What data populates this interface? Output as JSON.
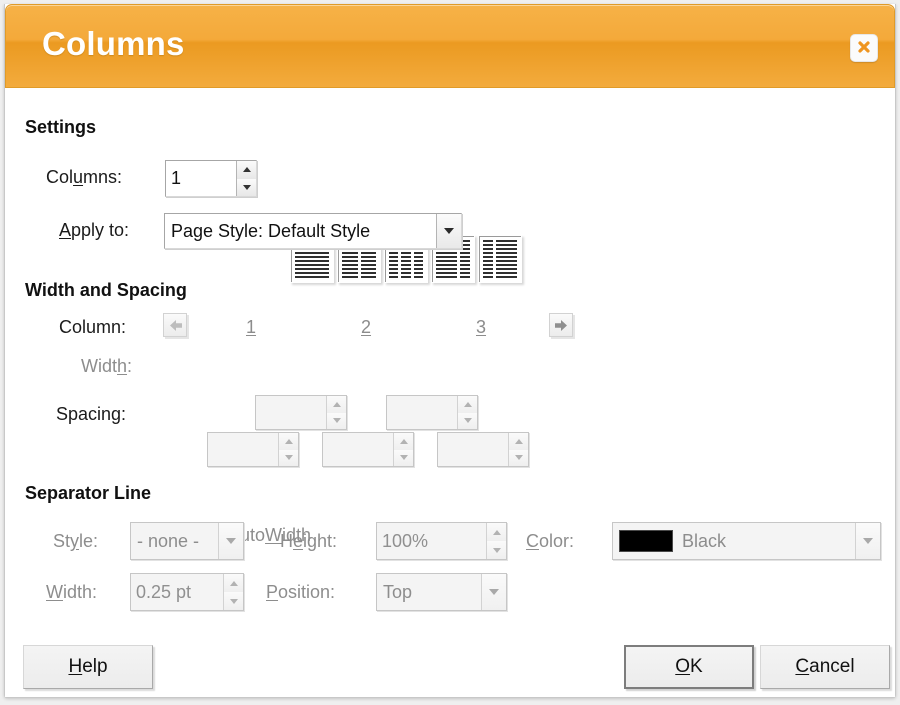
{
  "window": {
    "title": "Columns",
    "close_icon": "close-icon",
    "accent_color": "#f4a93a",
    "title_color": "#ffffff"
  },
  "settings": {
    "heading": "Settings",
    "columns_label_pre": "Col",
    "columns_label_accel": "u",
    "columns_label_post": "mns:",
    "columns_label": "Columns:",
    "columns_value": "1",
    "apply_to_label_accel": "A",
    "apply_to_label_post": "pply to:",
    "apply_to_label": "Apply to:",
    "apply_to_value": "Page Style: Default Style",
    "presets": [
      {
        "name": "preset-one-column",
        "widths": [
          1
        ]
      },
      {
        "name": "preset-two-columns",
        "widths": [
          1,
          1
        ]
      },
      {
        "name": "preset-three-columns",
        "widths": [
          1,
          1,
          1
        ]
      },
      {
        "name": "preset-left-wide",
        "widths": [
          2,
          1
        ]
      },
      {
        "name": "preset-right-wide",
        "widths": [
          1,
          2
        ]
      }
    ]
  },
  "width_spacing": {
    "heading": "Width and Spacing",
    "column_label": "Column:",
    "prev_icon": "arrow-left-icon",
    "next_icon": "arrow-right-icon",
    "column_numbers": [
      "1",
      "2",
      "3"
    ],
    "width_label_pre": "Widt",
    "width_label_accel": "h",
    "width_label_post": ":",
    "width_label": "Width:",
    "width_values": [
      "",
      "",
      ""
    ],
    "spacing_label": "Spacing:",
    "spacing_values": [
      "",
      ""
    ],
    "autowidth_pre": "Auto",
    "autowidth_accel": "W",
    "autowidth_post": "idth",
    "autowidth_label": "AutoWidth",
    "autowidth_checked": true,
    "autowidth_mark": "✓"
  },
  "separator_line": {
    "heading": "Separator Line",
    "style_label_pre": "St",
    "style_label_accel": "y",
    "style_label_post": "le:",
    "style_label": "Style:",
    "style_value": "- none -",
    "height_label_pre": "H",
    "height_label_accel": "e",
    "height_label_post": "ight:",
    "height_label": "Height:",
    "height_value": "100%",
    "color_label_accel": "C",
    "color_label_post": "olor:",
    "color_label": "Color:",
    "color_value": "Black",
    "color_hex": "#000000",
    "width_label_accel": "W",
    "width_label_post": "idth:",
    "width_label": "Width:",
    "width_value": "0.25 pt",
    "position_label_accel": "P",
    "position_label_post": "osition:",
    "position_label": "Position:",
    "position_value": "Top"
  },
  "buttons": {
    "help_accel": "H",
    "help_post": "elp",
    "help": "Help",
    "ok_accel": "O",
    "ok_post": "K",
    "ok": "OK",
    "cancel_accel": "C",
    "cancel_post": "ancel",
    "cancel": "Cancel"
  }
}
